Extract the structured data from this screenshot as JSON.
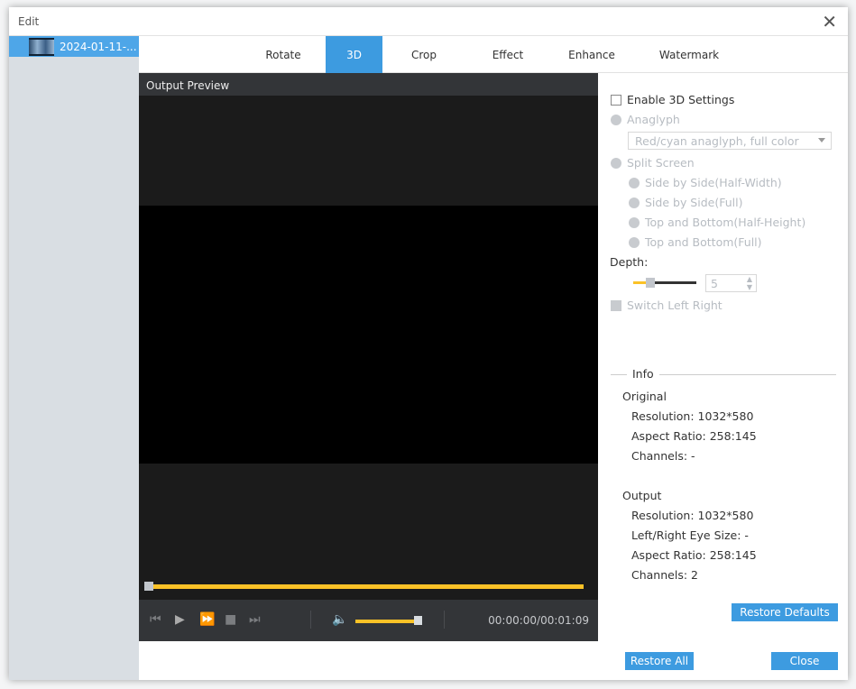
{
  "dialog": {
    "title": "Edit",
    "close_icon": "close-icon"
  },
  "sidebar": {
    "files": [
      {
        "name": "2024-01-11-..."
      }
    ]
  },
  "tabs": [
    {
      "label": "Rotate"
    },
    {
      "label": "3D",
      "active": true
    },
    {
      "label": "Crop"
    },
    {
      "label": "Effect"
    },
    {
      "label": "Enhance"
    },
    {
      "label": "Watermark"
    }
  ],
  "preview": {
    "header": "Output Preview",
    "time": "00:00:00/00:01:09",
    "seek_fraction": 0,
    "volume_fraction": 1.0
  },
  "settings": {
    "enable_3d": "Enable 3D Settings",
    "anaglyph": "Anaglyph",
    "anaglyph_select": "Red/cyan anaglyph, full color",
    "split_screen": "Split Screen",
    "split_options": [
      "Side by Side(Half-Width)",
      "Side by Side(Full)",
      "Top and Bottom(Half-Height)",
      "Top and Bottom(Full)"
    ],
    "depth_label": "Depth:",
    "depth_value": "5",
    "switch_lr": "Switch Left Right"
  },
  "info": {
    "title": "Info",
    "original_label": "Original",
    "original": [
      "Resolution: 1032*580",
      "Aspect Ratio: 258:145",
      "Channels: -"
    ],
    "output_label": "Output",
    "output": [
      "Resolution: 1032*580",
      "Left/Right Eye Size: -",
      "Aspect Ratio: 258:145",
      "Channels: 2"
    ]
  },
  "buttons": {
    "restore_defaults": "Restore Defaults",
    "restore_all": "Restore All",
    "close": "Close"
  },
  "colors": {
    "accent": "#3d9be0",
    "slider": "#fbc227"
  }
}
